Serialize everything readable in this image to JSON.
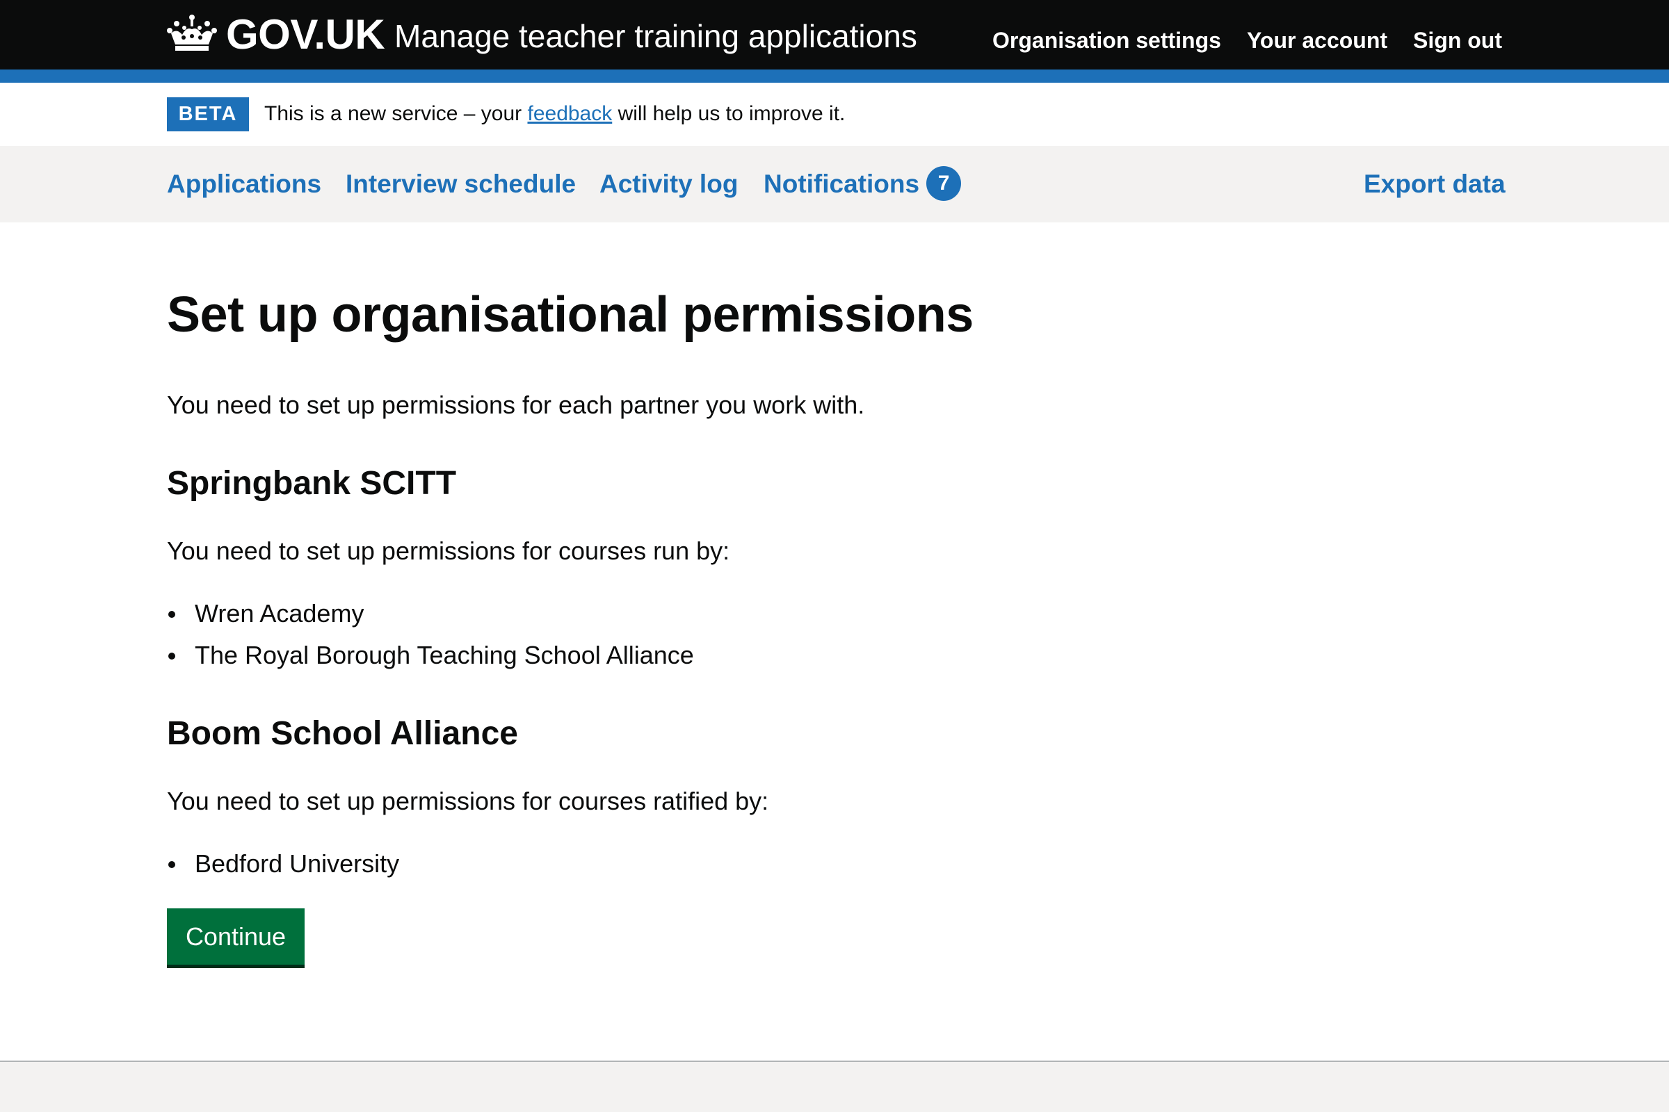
{
  "header": {
    "logotype": "GOV.UK",
    "service_name": "Manage teacher training applications",
    "nav": {
      "organisation_settings": "Organisation settings",
      "your_account": "Your account",
      "sign_out": "Sign out"
    }
  },
  "phase_banner": {
    "tag": "BETA",
    "text_before": "This is a new service – your ",
    "link": "feedback",
    "text_after": " will help us to improve it."
  },
  "primary_nav": {
    "applications": "Applications",
    "interview_schedule": "Interview schedule",
    "activity_log": "Activity log",
    "notifications": "Notifications",
    "notifications_count": "7",
    "export_data": "Export data"
  },
  "main": {
    "title": "Set up organisational permissions",
    "intro": "You need to set up permissions for each partner you work with.",
    "sections": [
      {
        "heading": "Springbank SCITT",
        "text": "You need to set up permissions for courses run by:",
        "items": [
          "Wren Academy",
          "The Royal Borough Teaching School Alliance"
        ]
      },
      {
        "heading": "Boom School Alliance",
        "text": "You need to set up permissions for courses ratified by:",
        "items": [
          "Bedford University"
        ]
      }
    ],
    "continue_label": "Continue"
  },
  "colors": {
    "header_bg": "#0b0c0c",
    "brand_blue": "#1d70b8",
    "button_green": "#00703c",
    "nav_bg": "#f3f2f1"
  }
}
